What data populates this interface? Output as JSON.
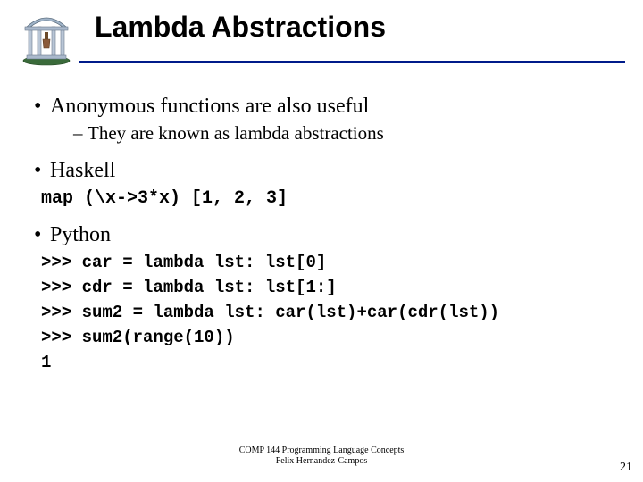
{
  "title": "Lambda Abstractions",
  "bullets": {
    "b1": "Anonymous functions are also useful",
    "b1_sub": "They are known as lambda abstractions",
    "b2": "Haskell",
    "b3": "Python"
  },
  "code": {
    "haskell": "map (\\x->3*x) [1, 2, 3]",
    "py1": ">>> car = lambda lst: lst[0]",
    "py2": ">>> cdr = lambda lst: lst[1:]",
    "py3": ">>> sum2 = lambda lst: car(lst)+car(cdr(lst))",
    "py4": ">>> sum2(range(10))",
    "py5": "1"
  },
  "footer": {
    "line1": "COMP 144 Programming Language Concepts",
    "line2": "Felix Hernandez-Campos"
  },
  "page_number": "21",
  "icon_name": "unc-old-well"
}
